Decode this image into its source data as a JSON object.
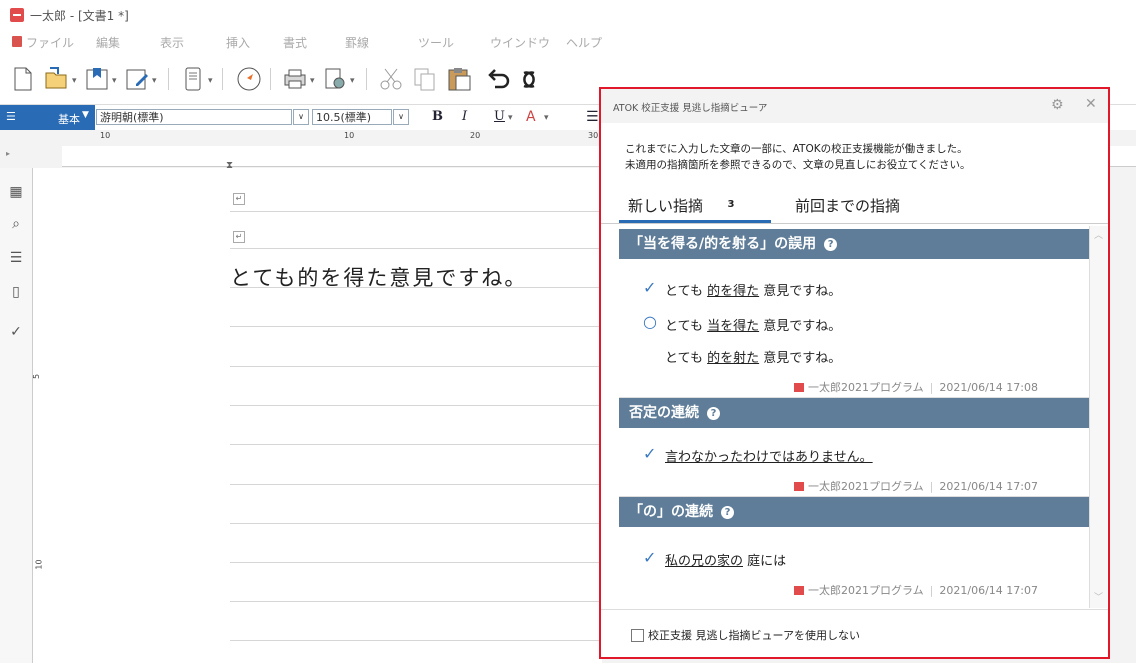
{
  "app": {
    "title": "一太郎 - [文書1 *]"
  },
  "menu": [
    "ファイル",
    "編集",
    "表示",
    "挿入",
    "書式",
    "罫線",
    "ツール",
    "ウインドウ",
    "ヘルプ"
  ],
  "formatbar": {
    "style_label": "基本",
    "font": "游明朝(標準)",
    "size": "10.5(標準)",
    "bold": "B",
    "italic": "I",
    "underline": "U"
  },
  "ruler": {
    "marks": [
      "10",
      "10",
      "20",
      "30"
    ]
  },
  "vruler": {
    "marks": [
      "5",
      "10"
    ]
  },
  "document": {
    "text": "とても的を得た意見ですね。"
  },
  "atok": {
    "title": "ATOK 校正支援 見逃し指摘ビューア",
    "desc_line1": "これまでに入力した文章の一部に、ATOKの校正支援機能が働きました。",
    "desc_line2": "未適用の指摘箇所を参照できるので、文章の見直しにお役立てください。",
    "tab_new": "新しい指摘",
    "tab_new_count": "3",
    "tab_prev": "前回までの指摘",
    "sections": [
      {
        "heading": "「当を得る/的を射る」の誤用",
        "items": [
          {
            "mark": "✓",
            "pre": "とても ",
            "u": "的を得た",
            "post": " 意見ですね。"
          },
          {
            "mark": "○",
            "pre": "とても ",
            "u": "当を得た",
            "post": " 意見ですね。"
          },
          {
            "mark": "",
            "pre": "とても ",
            "u": "的を射た",
            "post": " 意見ですね。"
          }
        ],
        "source": "一太郎2021プログラム",
        "date": "2021/06/14 17:08"
      },
      {
        "heading": "否定の連続",
        "items": [
          {
            "mark": "✓",
            "pre": "",
            "u": "言わなかったわけではありません。",
            "post": ""
          }
        ],
        "source": "一太郎2021プログラム",
        "date": "2021/06/14 17:07"
      },
      {
        "heading": "「の」の連続",
        "items": [
          {
            "mark": "✓",
            "pre": "",
            "u": "私の兄の家の",
            "post": " 庭には"
          }
        ],
        "source": "一太郎2021プログラム",
        "date": "2021/06/14 17:07"
      }
    ],
    "footer_checkbox": "校正支援 見逃し指摘ビューアを使用しない"
  },
  "colors": {
    "accent_blue": "#2a6bb5",
    "section_header": "#5f7d98",
    "highlight_border": "#e0182a"
  }
}
